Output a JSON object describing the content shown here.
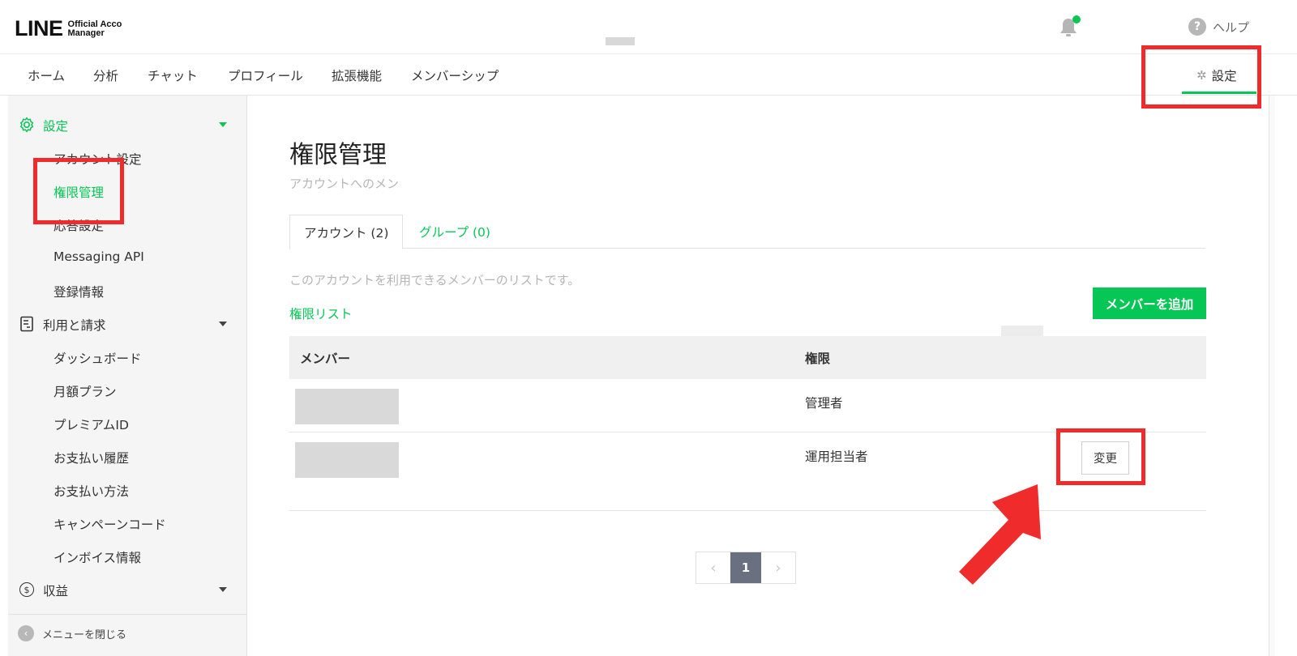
{
  "header": {
    "logo_main": "LINE",
    "logo_sub_line1": "Official Acco",
    "logo_sub_line2": "Manager",
    "help_label": "ヘルプ",
    "help_icon_glyph": "?",
    "notification_icon": "bell-icon"
  },
  "nav": {
    "items": [
      "ホーム",
      "分析",
      "チャット",
      "プロフィール",
      "拡張機能",
      "メンバーシップ"
    ],
    "settings_label": "設定"
  },
  "sidebar": {
    "settings_section": "設定",
    "settings_items": [
      "アカウント設定",
      "権限管理",
      "応答設定",
      "Messaging API",
      "登録情報"
    ],
    "billing_section": "利用と請求",
    "billing_items": [
      "ダッシュボード",
      "月額プラン",
      "プレミアムID",
      "お支払い履歴",
      "お支払い方法",
      "キャンペーンコード",
      "インボイス情報"
    ],
    "revenue_section": "収益",
    "revenue_icon_glyph": "$",
    "collapse_label": "メニューを閉じる",
    "collapse_icon_glyph": "‹"
  },
  "main": {
    "title": "権限管理",
    "description": "アカウントへのメン",
    "tabs": [
      {
        "label": "アカウント (2)",
        "active": true
      },
      {
        "label": "グループ (0)",
        "active": false
      }
    ],
    "list_description": "このアカウントを利用できるメンバーのリストです。",
    "permission_list_link": "権限リスト",
    "add_member_button": "メンバーを追加",
    "table": {
      "headers": {
        "member": "メンバー",
        "permission": "権限"
      },
      "rows": [
        {
          "permission": "管理者",
          "has_change_button": false
        },
        {
          "permission": "運用担当者",
          "has_change_button": true
        }
      ],
      "change_button": "変更"
    },
    "pagination": {
      "current_page": "1",
      "prev_glyph": "‹",
      "next_glyph": "›"
    }
  },
  "colors": {
    "accent": "#06c755",
    "annotation_red": "#f02b2b",
    "pager_active": "#6b7080"
  }
}
